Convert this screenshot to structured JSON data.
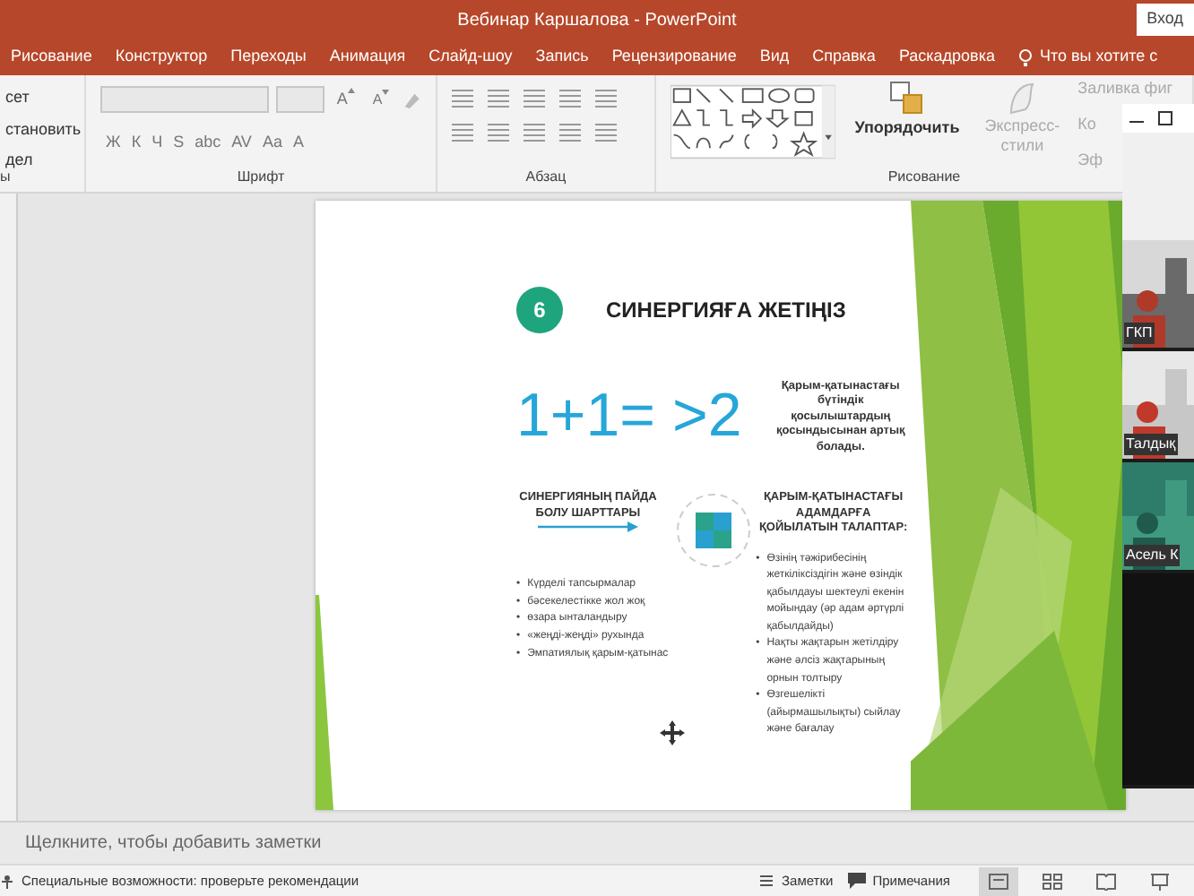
{
  "window": {
    "title": "Вебинар Каршалова  -  PowerPoint",
    "sign_in": "Вход"
  },
  "ribbon_tabs": [
    {
      "label": "Рисование",
      "selected": false
    },
    {
      "label": "Конструктор",
      "selected": false
    },
    {
      "label": "Переходы",
      "selected": false
    },
    {
      "label": "Анимация",
      "selected": false
    },
    {
      "label": "Слайд-шоу",
      "selected": false
    },
    {
      "label": "Запись",
      "selected": false
    },
    {
      "label": "Рецензирование",
      "selected": false
    },
    {
      "label": "Вид",
      "selected": false
    },
    {
      "label": "Справка",
      "selected": false
    },
    {
      "label": "Раскадровка",
      "selected": false
    }
  ],
  "tell_me": "Что вы хотите с",
  "slides_group": {
    "items": [
      "сет",
      "становить",
      "дел"
    ],
    "label": "ы"
  },
  "font_group": {
    "label": "Шрифт",
    "grow": "A",
    "shrink": "A",
    "buttons": [
      "Ж",
      "К",
      "Ч",
      "S",
      "abc",
      "AV",
      "Aa",
      "A"
    ]
  },
  "paragraph_group": {
    "label": "Абзац"
  },
  "drawing_group": {
    "label": "Рисование",
    "arrange": "Упорядочить",
    "quick_styles": {
      "label": [
        "Экспресс-",
        "стили"
      ],
      "disabled": true
    },
    "shape_options": [
      {
        "label": "Заливка фиг",
        "disabled": true
      },
      {
        "label": "Ко",
        "disabled": true
      },
      {
        "label": "Эф",
        "disabled": true
      }
    ]
  },
  "slide": {
    "number": "6",
    "title": "СИНЕРГИЯҒА ЖЕТІҢІЗ",
    "formula": "1+1= >2",
    "statement": "Қарым-қатынастағы бүтіндік қосылыштардың қосындысынан артық болады.",
    "left": {
      "heading": "СИНЕРГИЯНЫҢ ПАЙДА БОЛУ ШАРТТАРЫ",
      "bullets": [
        {
          "mark": "•",
          "text": "Күрделі тапсырмалар"
        },
        {
          "mark": "•",
          "text": "бәсекелестікке жол жоқ"
        },
        {
          "mark": "•",
          "text": "өзара ынталандыру"
        },
        {
          "mark": "•",
          "text": "«жеңді-жеңді» рухында"
        },
        {
          "mark": "•",
          "text": "Эмпатиялық қарым-қатынас"
        }
      ]
    },
    "right": {
      "heading": "ҚАРЫМ-ҚАТЫНАСТАҒЫ АДАМДАРҒА ҚОЙЫЛАТЫН ТАЛАПТАР:",
      "bullets": [
        {
          "mark": "•",
          "text": "Өзінің тәжірибесінің жеткіліксіздігін және өзіндік қабылдауы шектеулі екенін мойындау (әр адам әртүрлі қабылдайды)"
        },
        {
          "mark": "•",
          "text": "Нақты жақтарын жетілдіру және әлсіз жақтарының орнын толтыру"
        },
        {
          "mark": "•",
          "text": "Өзгешелікті (айырмашылықты) сыйлау және бағалау"
        }
      ]
    }
  },
  "video_tiles": [
    {
      "label": "ГКП",
      "kind": "picture"
    },
    {
      "label": "Талдық",
      "kind": "picture"
    },
    {
      "label": "Асель К",
      "kind": "picture"
    },
    {
      "kind": "dark"
    }
  ],
  "notes": {
    "placeholder": "Щелкните, чтобы добавить заметки"
  },
  "status_bar": {
    "accessibility": "Специальные возможности: проверьте рекомендации",
    "notes": "Заметки",
    "comments": "Примечания",
    "views": [
      {
        "selected": true
      },
      {
        "selected": false
      },
      {
        "selected": false
      },
      {
        "selected": false
      }
    ]
  }
}
